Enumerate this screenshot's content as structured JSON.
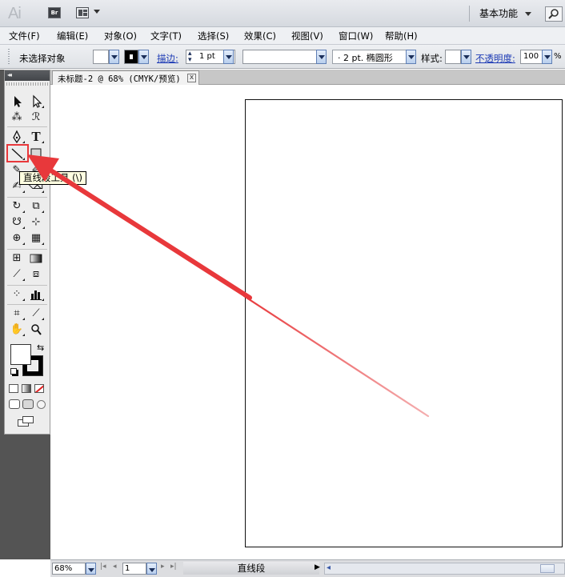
{
  "app": {
    "logo": "Ai",
    "bridge_label": "Br",
    "workspace": "基本功能"
  },
  "menu": [
    {
      "label": "文件(F)"
    },
    {
      "label": "编辑(E)"
    },
    {
      "label": "对象(O)"
    },
    {
      "label": "文字(T)"
    },
    {
      "label": "选择(S)"
    },
    {
      "label": "效果(C)"
    },
    {
      "label": "视图(V)"
    },
    {
      "label": "窗口(W)"
    },
    {
      "label": "帮助(H)"
    }
  ],
  "control": {
    "selection_status": "未选择对象",
    "stroke_label": "描边:",
    "stroke_weight": "1 pt",
    "brush_profile": "· 2 pt. 椭圆形",
    "style_label": "样式:",
    "opacity_label": "不透明度:",
    "opacity_value": "100",
    "percent": "%"
  },
  "document": {
    "tab_title": "未标题-2 @ 68% (CMYK/预览)",
    "close_glyph": "x"
  },
  "tooltip": {
    "text": "直线段工具 (\\)"
  },
  "status": {
    "zoom": "68%",
    "page": "1",
    "current_tool": "直线段"
  },
  "colors": {
    "annotation_red": "#e8383b",
    "drawn_line_red": "#ec5a5c",
    "link_blue": "#1c3ab5"
  }
}
